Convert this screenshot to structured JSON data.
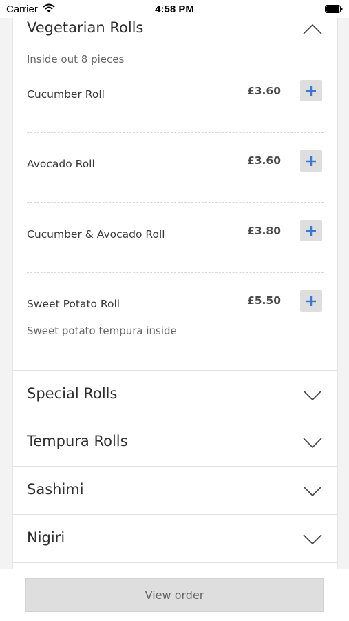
{
  "status_bar": {
    "carrier": "Carrier",
    "time": "4:58 PM"
  },
  "menu": {
    "expanded_section": {
      "title": "Vegetarian Rolls",
      "subtitle": "Inside out 8 pieces",
      "items": [
        {
          "name": "Cucumber Roll",
          "price": "£3.60"
        },
        {
          "name": "Avocado Roll",
          "price": "£3.60"
        },
        {
          "name": "Cucumber & Avocado Roll",
          "price": "£3.80"
        },
        {
          "name": "Sweet Potato Roll",
          "price": "£5.50",
          "description": "Sweet potato tempura inside"
        }
      ]
    },
    "collapsed_sections": [
      {
        "title": "Special Rolls"
      },
      {
        "title": "Tempura Rolls"
      },
      {
        "title": "Sashimi"
      },
      {
        "title": "Nigiri"
      }
    ]
  },
  "bottom_bar": {
    "view_order_label": "View order"
  },
  "colors": {
    "accent": "#3a78d6",
    "button_bg": "#dedede"
  }
}
